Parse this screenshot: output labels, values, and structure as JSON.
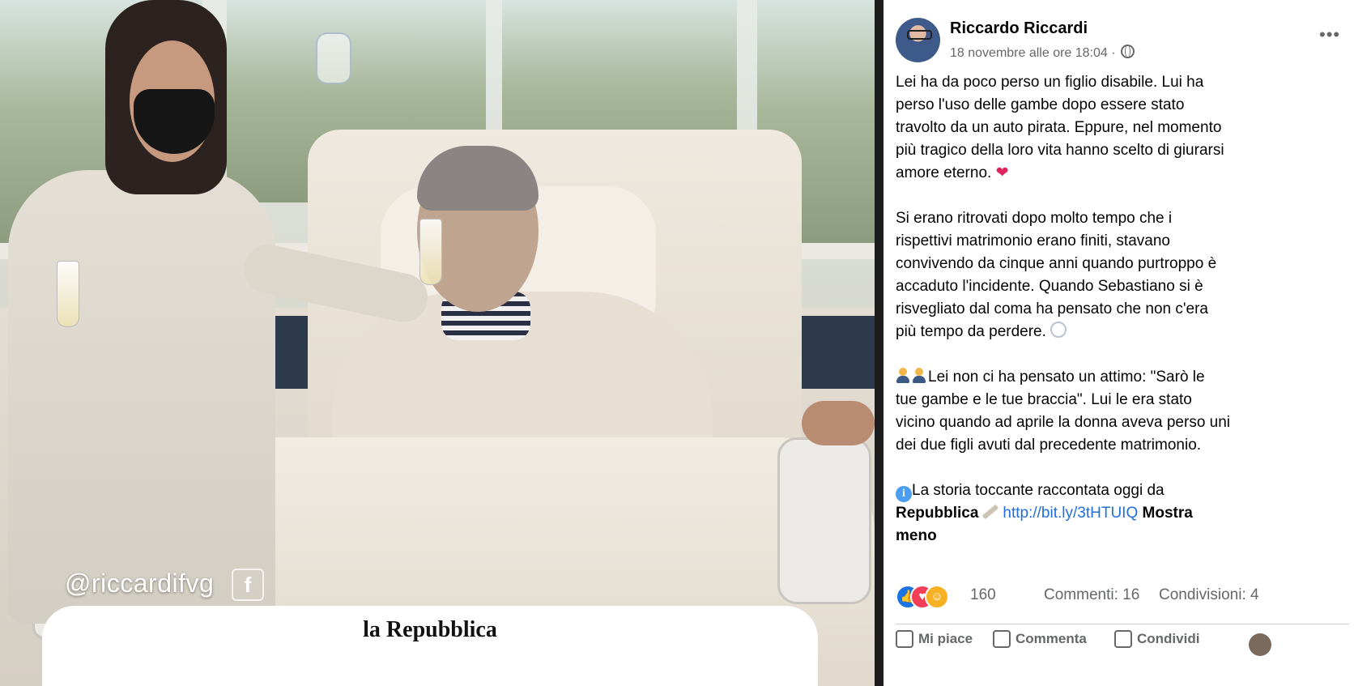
{
  "photo": {
    "watermark": "@riccardifvg",
    "watermark_icon": "facebook-icon",
    "newspaper_logo": "la Repubblica"
  },
  "post": {
    "author": "Riccardo Riccardi",
    "time": "18 novembre alle ore 18:04 ·",
    "more_icon": "more-options-icon",
    "paragraphs": {
      "p1_l1": "Lei ha da poco perso un figlio disabile. Lui ha",
      "p1_l2": "perso l'uso delle gambe dopo essere stato",
      "p1_l3": "travolto da un auto pirata. Eppure, nel momento",
      "p1_l4": "più tragico della loro vita hanno scelto di giurarsi",
      "p1_l5": "amore eterno.",
      "p2_l1": "Si erano ritrovati dopo molto tempo che i",
      "p2_l2": "rispettivi matrimonio erano finiti, stavano",
      "p2_l3": "convivendo da cinque anni quando purtroppo è",
      "p2_l4": "accaduto l'incidente. Quando Sebastiano si è",
      "p2_l5": "risvegliato dal coma ha pensato che non c'era",
      "p2_l6": "più tempo da perdere.",
      "p3_l1": "Lei non ci ha pensato un attimo: \"Sarò le",
      "p3_l2": "tue gambe e le tue braccia\". Lui le era stato",
      "p3_l3": "vicino quando ad aprile la donna aveva perso uni",
      "p3_l4": "dei due figli avuti dal precedente matrimonio.",
      "p4_l1": "La storia toccante raccontata oggi da",
      "p4_source": "Repubblica",
      "p4_link": "http://bit.ly/3tHTUIQ",
      "p4_more1": "Mostra",
      "p4_more2": "meno"
    },
    "emojis": [
      "heart-emoji",
      "ring-emoji",
      "couple-emoji",
      "info-icon",
      "newspaper-emoji"
    ],
    "reactions": {
      "icons": [
        "like-icon",
        "love-icon",
        "care-icon"
      ],
      "count": "160",
      "comments": "Commenti: 16",
      "shares": "Condivisioni: 4"
    },
    "actions": {
      "like": "Mi piace",
      "comment": "Commenta",
      "share": "Condividi"
    }
  },
  "colors": {
    "link": "#216fdb",
    "secondary_text": "#65676b",
    "like_blue": "#1b74e4",
    "love_red": "#f33e58"
  }
}
